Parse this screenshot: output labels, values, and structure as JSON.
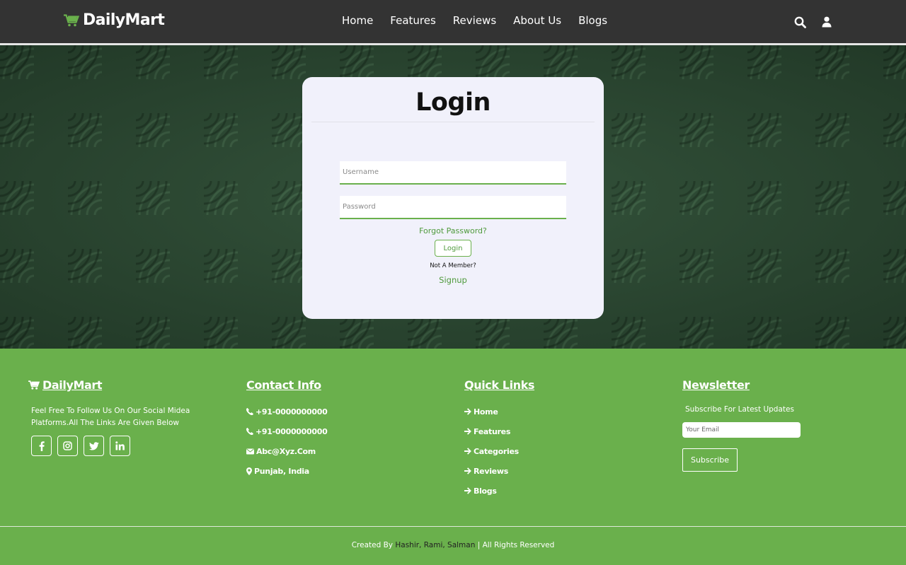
{
  "header": {
    "logo_text": "DailyMart",
    "nav": [
      "Home",
      "Features",
      "Reviews",
      "About Us",
      "Blogs"
    ],
    "icons": [
      "search-icon",
      "user-icon"
    ]
  },
  "login": {
    "title": "Login",
    "username_placeholder": "Username",
    "password_placeholder": "Password",
    "forgot_label": "Forgot Password?",
    "login_button": "Login",
    "not_member_text": "Not A Member?",
    "signup_label": "Signup"
  },
  "footer": {
    "brand": {
      "title": "DailyMart",
      "description": "Feel Free To Follow Us On Our Social Midea Platforms.All The Links Are Given Below",
      "socials": [
        "facebook-icon",
        "instagram-icon",
        "twitter-icon",
        "linkedin-icon"
      ]
    },
    "contact": {
      "title": "Contact Info",
      "phone_1": "+91-0000000000",
      "phone_2": "+91-0000000000",
      "email": "Abc@Xyz.Com",
      "location": "Punjab, India"
    },
    "quick_links": {
      "title": "Quick Links",
      "links": [
        "Home",
        "Features",
        "Categories",
        "Reviews",
        "Blogs"
      ]
    },
    "newsletter": {
      "title": "Newsletter",
      "text": "Subscribe For Latest Updates",
      "email_placeholder": "Your Email",
      "button": "Subscribe"
    },
    "credit": {
      "prefix": "Created By ",
      "names": "Hashir, Rami, Salman",
      "suffix": " | All Rights Reserved"
    }
  },
  "colors": {
    "header_bg": "#333333",
    "accent_green": "#6ab04c",
    "card_bg": "#f1f1fb",
    "hero_green": "#2e4a34"
  }
}
